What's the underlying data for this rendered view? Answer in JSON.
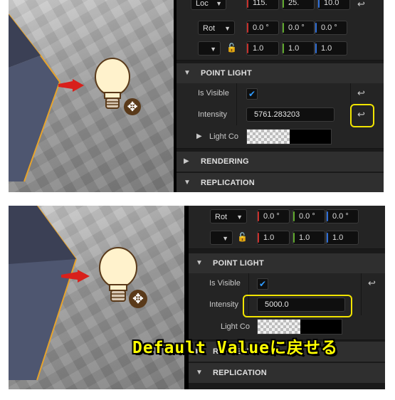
{
  "top": {
    "transform_partial": {
      "dropdown": "Loc",
      "values": [
        "115.",
        "25.",
        "10.0"
      ]
    },
    "rotation": {
      "label": "Rot",
      "values": [
        "0.0 °",
        "0.0 °",
        "0.0 °"
      ]
    },
    "scale": {
      "values": [
        "1.0",
        "1.0",
        "1.0"
      ]
    },
    "section_point_light": "POINT LIGHT",
    "is_visible_label": "Is Visible",
    "intensity_label": "Intensity",
    "intensity_value": "5761.283203",
    "light_color_label": "Light Co",
    "section_rendering": "RENDERING",
    "section_replication": "REPLICATION"
  },
  "bottom": {
    "rotation": {
      "label": "Rot",
      "values": [
        "0.0 °",
        "0.0 °",
        "0.0 °"
      ]
    },
    "scale": {
      "values": [
        "1.0",
        "1.0",
        "1.0"
      ]
    },
    "section_point_light": "POINT LIGHT",
    "is_visible_label": "Is Visible",
    "intensity_label": "Intensity",
    "intensity_value": "5000.0",
    "light_color_label": "Light Co",
    "section_rendering": "RENDERING",
    "section_replication": "REPLICATION"
  },
  "caption": "Default Valueに戻せる",
  "icons": {
    "reset": "reset-to-default-arrow-icon",
    "lock": "lock-icon",
    "move": "move-arrows-icon",
    "bulb": "point-light-bulb-icon",
    "check": "checkmark-icon",
    "chevron": "chevron-icon"
  },
  "colors": {
    "highlight": "#f1e400",
    "caption": "#ffff00",
    "checkbox": "#2f9bff",
    "light_arrow": "#d8201b",
    "cube_edge": "#e0a030"
  }
}
